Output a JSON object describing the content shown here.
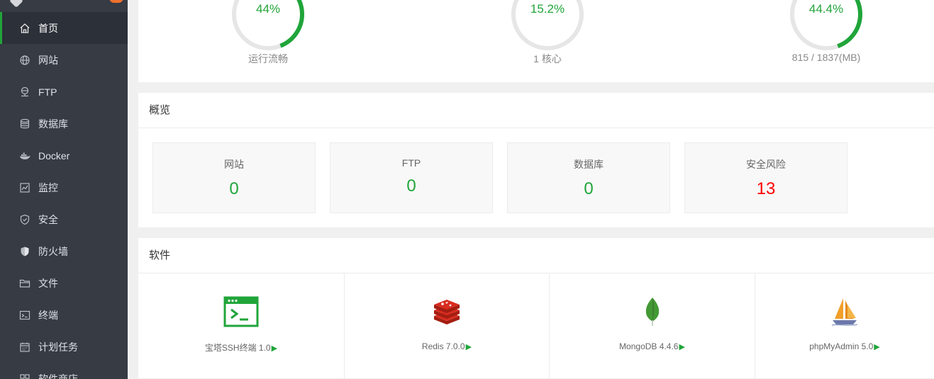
{
  "nav": [
    {
      "label": "首页",
      "icon": "home-icon"
    },
    {
      "label": "网站",
      "icon": "globe-icon"
    },
    {
      "label": "FTP",
      "icon": "ftp-icon"
    },
    {
      "label": "数据库",
      "icon": "database-icon"
    },
    {
      "label": "Docker",
      "icon": "docker-icon"
    },
    {
      "label": "监控",
      "icon": "monitor-icon"
    },
    {
      "label": "安全",
      "icon": "shield-icon"
    },
    {
      "label": "防火墙",
      "icon": "firewall-icon"
    },
    {
      "label": "文件",
      "icon": "folder-icon"
    },
    {
      "label": "终端",
      "icon": "terminal-icon"
    },
    {
      "label": "计划任务",
      "icon": "calendar-icon"
    },
    {
      "label": "软件商店",
      "icon": "store-icon"
    }
  ],
  "status": {
    "load": {
      "percent": "44%",
      "value": 0.44,
      "sub": "运行流畅"
    },
    "cpu": {
      "percent": "15.2%",
      "value": 0.152,
      "sub": "1 核心"
    },
    "memory": {
      "percent": "44.4%",
      "value": 0.444,
      "sub": "815 / 1837(MB)"
    }
  },
  "overview": {
    "title": "概览",
    "cards": [
      {
        "label": "网站",
        "value": "0"
      },
      {
        "label": "FTP",
        "value": "0"
      },
      {
        "label": "数据库",
        "value": "0"
      },
      {
        "label": "安全风险",
        "value": "13"
      }
    ]
  },
  "software": {
    "title": "软件",
    "items": [
      {
        "name": "宝塔SSH终端 1.0",
        "icon": "terminal-app-icon"
      },
      {
        "name": "Redis 7.0.0",
        "icon": "redis-icon"
      },
      {
        "name": "MongoDB 4.4.6",
        "icon": "mongodb-leaf-icon"
      },
      {
        "name": "phpMyAdmin 5.0",
        "icon": "phpmyadmin-sailboat-icon"
      }
    ],
    "play_glyph": "▶"
  },
  "colors": {
    "accent": "#20a53a",
    "risk": "#ff0000",
    "sidebar": "#363b44"
  }
}
